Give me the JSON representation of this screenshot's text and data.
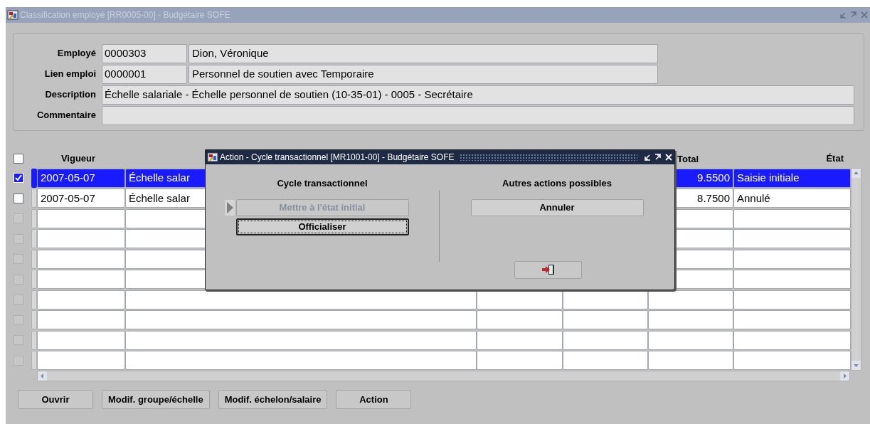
{
  "window": {
    "title": "Classification employé [RR0005-00] - Budgétaire SOFE"
  },
  "header": {
    "fields": [
      {
        "kind": "pair",
        "label": "Employé",
        "code": "0000303",
        "value": "Dion, Véronique"
      },
      {
        "kind": "pair",
        "label": "Lien emploi",
        "code": "0000001",
        "value": "Personnel de soutien avec Temporaire"
      },
      {
        "kind": "wide",
        "label": "Description",
        "value": "Échelle salariale - Échelle personnel de soutien (10-35-01) - 0005 - Secrétaire"
      },
      {
        "kind": "wide",
        "label": "Commentaire"
      }
    ]
  },
  "table": {
    "select_all": {
      "checked": false
    },
    "columns": {
      "vigueur": "Vigueur",
      "total": "Total",
      "etat": "État"
    },
    "rows": [
      {
        "checked": true,
        "disabled": false,
        "selected": true,
        "vigueur": "2007-05-07",
        "column_2": "Échelle salar",
        "total": "9.5500",
        "etat": "Saisie initiale"
      },
      {
        "checked": false,
        "disabled": false,
        "selected": false,
        "vigueur": "2007-05-07",
        "column_2": "Échelle salar",
        "total": "8.7500",
        "etat": "Annulé"
      },
      {
        "checked": false,
        "disabled": true,
        "selected": false
      },
      {
        "checked": false,
        "disabled": true,
        "selected": false
      },
      {
        "checked": false,
        "disabled": true,
        "selected": false
      },
      {
        "checked": false,
        "disabled": true,
        "selected": false
      },
      {
        "checked": false,
        "disabled": true,
        "selected": false
      },
      {
        "checked": false,
        "disabled": true,
        "selected": false
      },
      {
        "checked": false,
        "disabled": true,
        "selected": false
      },
      {
        "checked": false,
        "disabled": true,
        "selected": false
      }
    ]
  },
  "dialog": {
    "title": "Action - Cycle transactionnel [MR1001-00] - Budgétaire SOFE",
    "left": {
      "heading": "Cycle transactionnel",
      "buttons": [
        {
          "label": "Mettre à l'état initial",
          "disabled": true,
          "focused": false,
          "current": true
        },
        {
          "label": "Officialiser",
          "disabled": false,
          "focused": true,
          "current": false
        }
      ]
    },
    "right": {
      "heading": "Autres actions possibles",
      "buttons": [
        {
          "label": "Annuler",
          "disabled": false,
          "focused": false,
          "current": false
        }
      ]
    }
  },
  "buttons": [
    "Ouvrir",
    "Modif. groupe/échelle",
    "Modif. échelon/salaire",
    "Action"
  ]
}
